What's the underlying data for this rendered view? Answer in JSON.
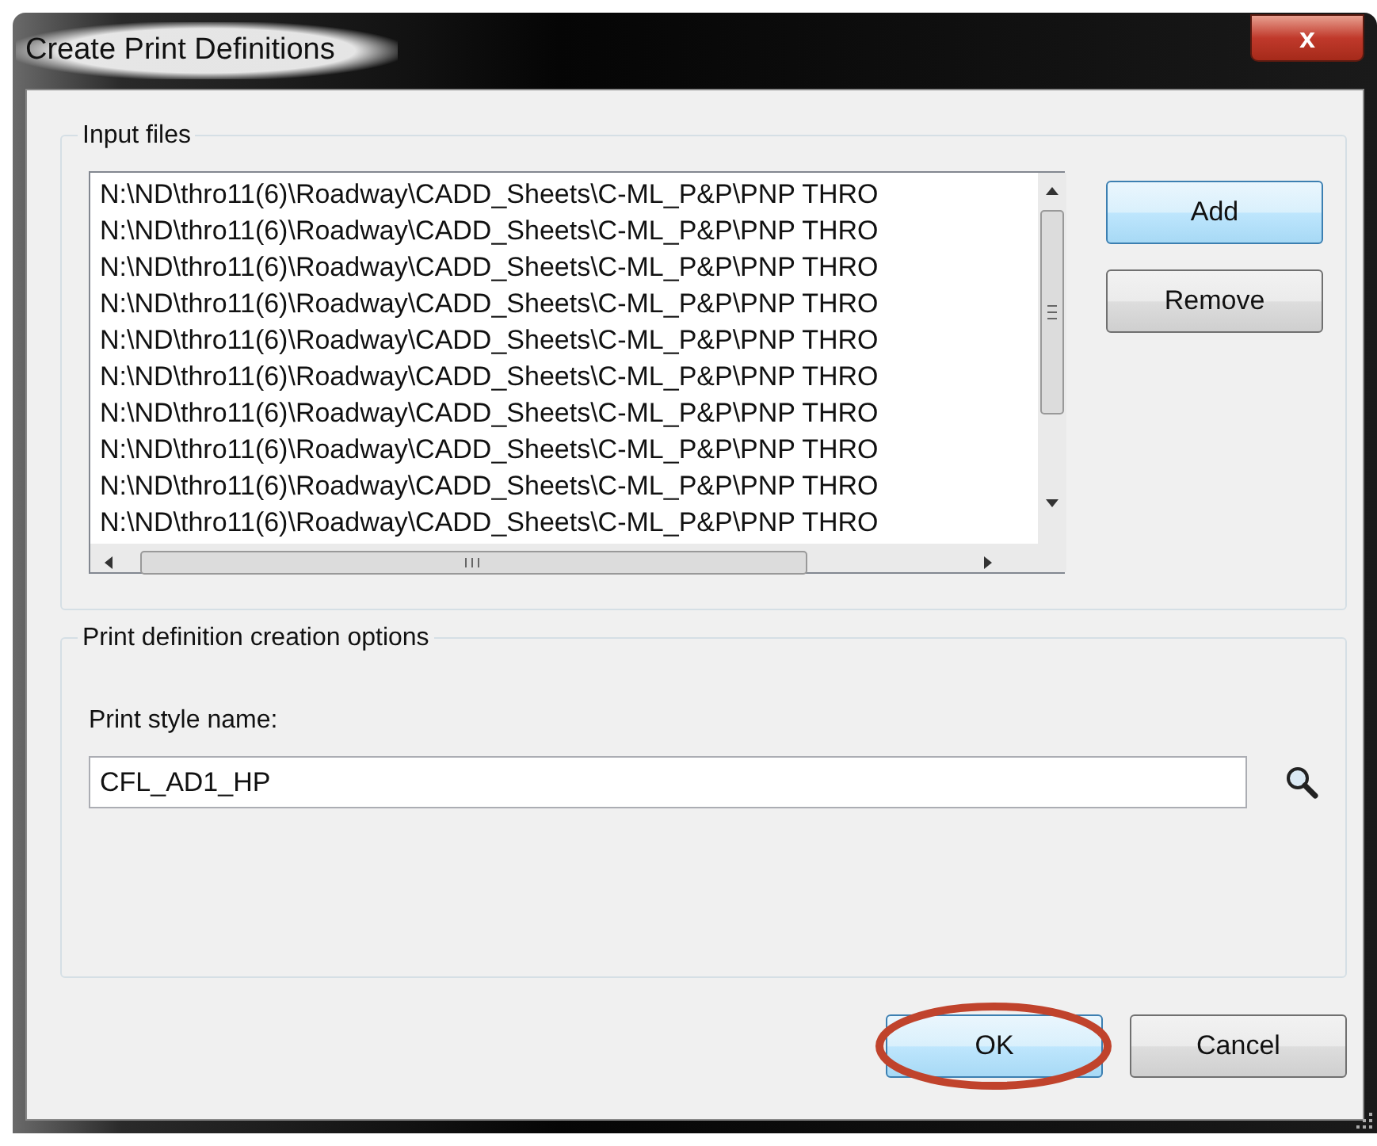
{
  "window": {
    "title": "Create Print Definitions",
    "close": "x"
  },
  "input_files": {
    "title": "Input files",
    "files": [
      "N:\\ND\\thro11(6)\\Roadway\\CADD_Sheets\\C-ML_P&P\\PNP THRO",
      "N:\\ND\\thro11(6)\\Roadway\\CADD_Sheets\\C-ML_P&P\\PNP THRO",
      "N:\\ND\\thro11(6)\\Roadway\\CADD_Sheets\\C-ML_P&P\\PNP THRO",
      "N:\\ND\\thro11(6)\\Roadway\\CADD_Sheets\\C-ML_P&P\\PNP THRO",
      "N:\\ND\\thro11(6)\\Roadway\\CADD_Sheets\\C-ML_P&P\\PNP THRO",
      "N:\\ND\\thro11(6)\\Roadway\\CADD_Sheets\\C-ML_P&P\\PNP THRO",
      "N:\\ND\\thro11(6)\\Roadway\\CADD_Sheets\\C-ML_P&P\\PNP THRO",
      "N:\\ND\\thro11(6)\\Roadway\\CADD_Sheets\\C-ML_P&P\\PNP THRO",
      "N:\\ND\\thro11(6)\\Roadway\\CADD_Sheets\\C-ML_P&P\\PNP THRO",
      "N:\\ND\\thro11(6)\\Roadway\\CADD_Sheets\\C-ML_P&P\\PNP THRO"
    ],
    "buttons": [
      {
        "label": "Add",
        "focused": true
      },
      {
        "label": "Remove",
        "focused": false
      }
    ]
  },
  "options": {
    "title": "Print definition creation options",
    "field_label": "Print style name:",
    "field_value": "CFL_AD1_HP"
  },
  "footer_buttons": [
    {
      "label": "OK",
      "focused": true,
      "highlighted": true
    },
    {
      "label": "Cancel",
      "focused": false,
      "highlighted": false
    }
  ]
}
